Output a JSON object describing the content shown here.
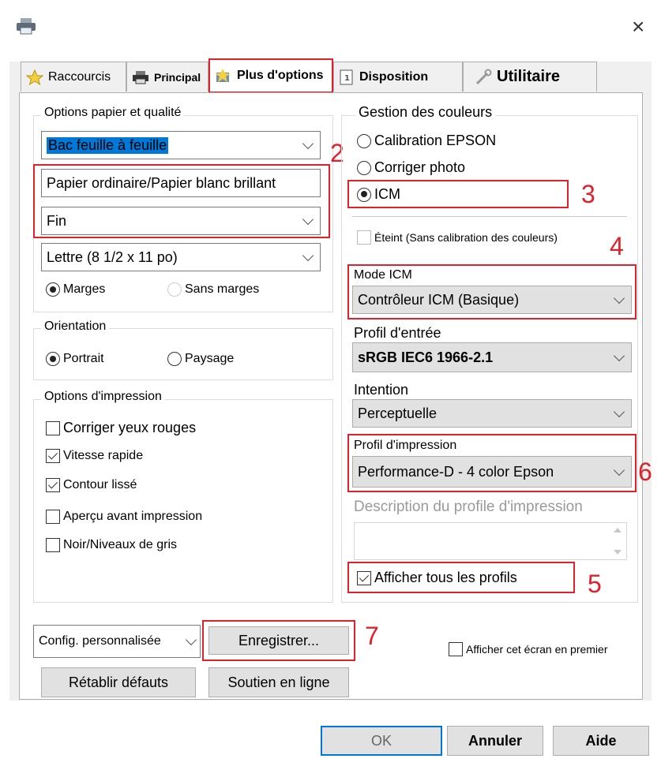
{
  "window": {
    "close_glyph": "×"
  },
  "tabs": [
    {
      "label": "Raccourcis",
      "icon": "star-icon"
    },
    {
      "label": "Principal",
      "icon": "printer-icon"
    },
    {
      "label": "Plus d'options",
      "icon": "paint-icon"
    },
    {
      "label": "Disposition",
      "icon": "page-icon"
    },
    {
      "label": "Utilitaire",
      "icon": "wrench-icon"
    }
  ],
  "paper": {
    "legend": "Options papier et qualité",
    "source": "Bac feuille à feuille",
    "type": "Papier ordinaire/Papier blanc brillant",
    "quality": "Fin",
    "size": "Lettre (8 1/2 x 11 po)",
    "margins": "Marges",
    "borderless": "Sans marges"
  },
  "orientation": {
    "legend": "Orientation",
    "portrait": "Portrait",
    "landscape": "Paysage"
  },
  "print_options": {
    "legend": "Options d'impression",
    "items": [
      {
        "label": "Corriger yeux rouges",
        "checked": false
      },
      {
        "label": "Vitesse rapide",
        "checked": true
      },
      {
        "label": "Contour lissé",
        "checked": true
      },
      {
        "label": "Aperçu avant impression",
        "checked": false
      },
      {
        "label": "Noir/Niveaux de gris",
        "checked": false
      }
    ]
  },
  "color": {
    "legend": "Gestion des couleurs",
    "epson": "Calibration EPSON",
    "photo": "Corriger photo",
    "icm": "ICM",
    "off": "Éteint (Sans calibration des couleurs)",
    "mode_label": "Mode ICM",
    "mode_value": "Contrôleur ICM (Basique)",
    "input_label": "Profil d'entrée",
    "input_value": "sRGB IEC6 1966-2.1",
    "intent_label": "Intention",
    "intent_value": "Perceptuelle",
    "print_profile_label": "Profil d'impression",
    "print_profile_value": "Performance-D - 4 color Epson",
    "desc_label": "Description du profile d'impression",
    "show_all": "Afficher tous les profils"
  },
  "bottom": {
    "custom_config": "Config. personnalisée",
    "save": "Enregistrer...",
    "show_first": "Afficher cet écran en premier",
    "reset": "Rétablir défauts",
    "support": "Soutien en ligne"
  },
  "footer": {
    "ok": "OK",
    "cancel": "Annuler",
    "help": "Aide"
  },
  "annotations": [
    "2",
    "3",
    "4",
    "6",
    "5",
    "7"
  ],
  "colors": {
    "highlight": "#0078d7",
    "annotation_red": "#e0202a"
  }
}
